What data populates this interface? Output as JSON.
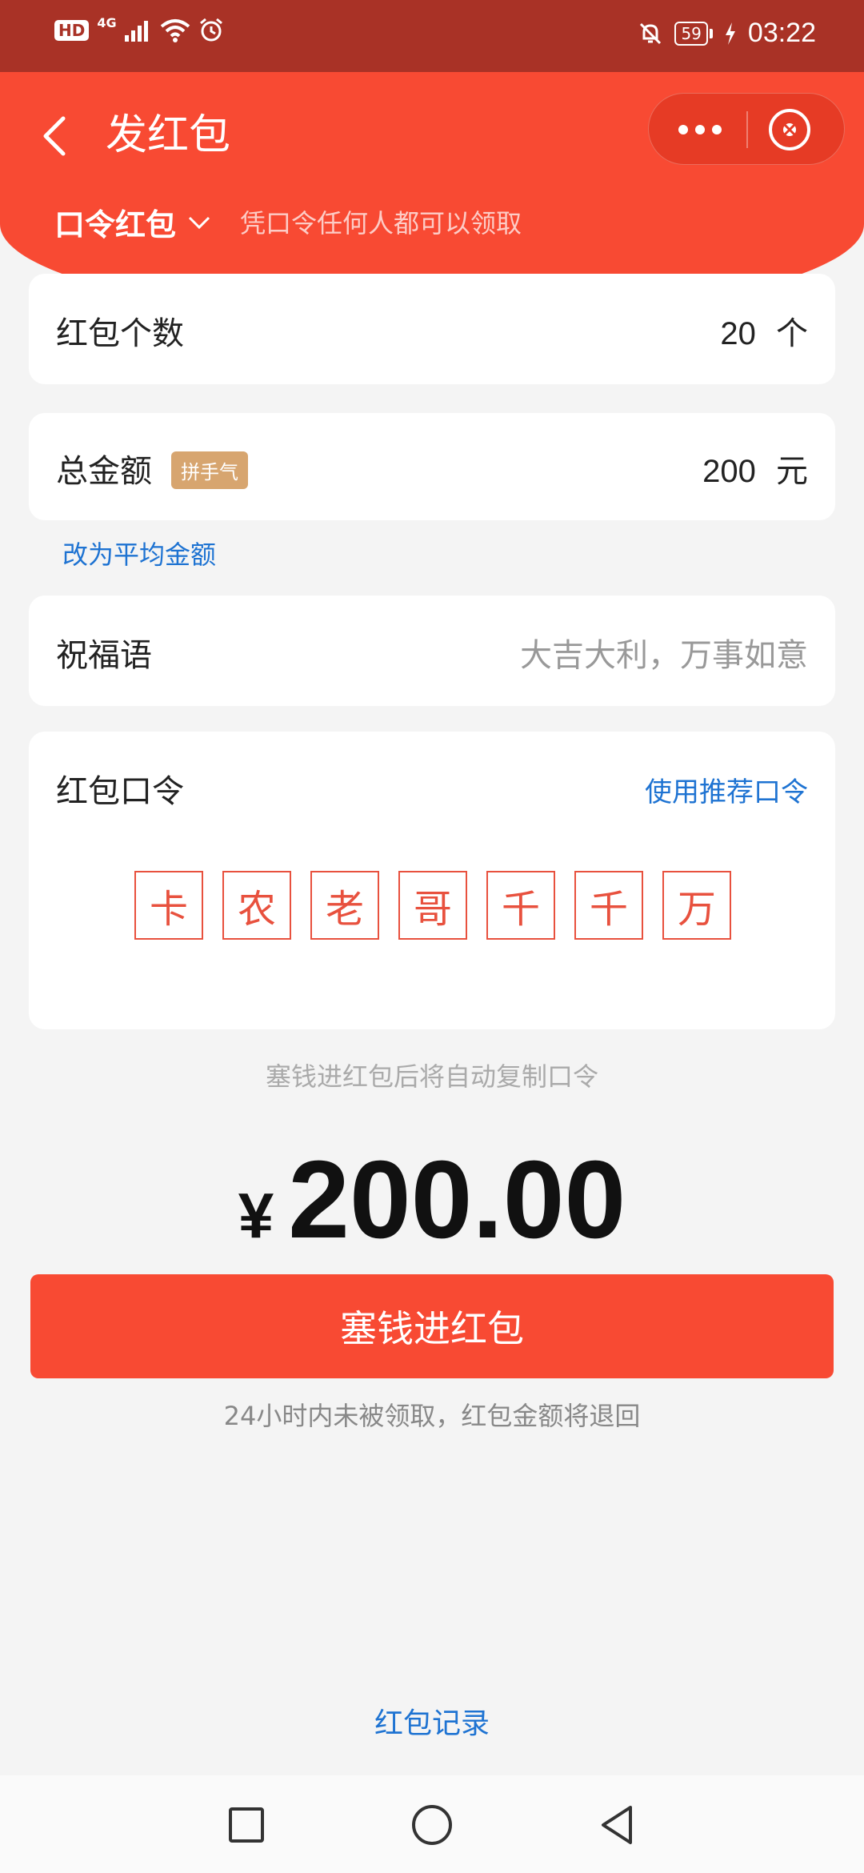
{
  "status_bar": {
    "network": "4G",
    "battery": "59",
    "time": "03:22",
    "icons": [
      "hd-icon",
      "signal-icon",
      "wifi-icon",
      "alarm-icon",
      "mute-icon",
      "battery-icon",
      "charging-icon"
    ]
  },
  "header": {
    "title": "发红包",
    "packet_type": "口令红包",
    "packet_hint": "凭口令任何人都可以领取"
  },
  "count": {
    "label": "红包个数",
    "value": "20",
    "unit": "个"
  },
  "total": {
    "label": "总金额",
    "badge": "拼手气",
    "value": "200",
    "unit": "元",
    "switch_link": "改为平均金额"
  },
  "blessing": {
    "label": "祝福语",
    "placeholder": "大吉大利，万事如意"
  },
  "password": {
    "label": "红包口令",
    "recommend_link": "使用推荐口令",
    "chars": [
      "卡",
      "农",
      "老",
      "哥",
      "千",
      "千",
      "万"
    ]
  },
  "copy_hint": "塞钱进红包后将自动复制口令",
  "amount": {
    "currency": "¥",
    "value": "200.00"
  },
  "submit_label": "塞钱进红包",
  "refund_note": "24小时内未被领取，红包金额将退回",
  "records_link": "红包记录",
  "colors": {
    "brand_red": "#f84a33",
    "status_bar": "#a93226",
    "link_blue": "#1e73d2",
    "badge_gold": "#d7a56f"
  }
}
